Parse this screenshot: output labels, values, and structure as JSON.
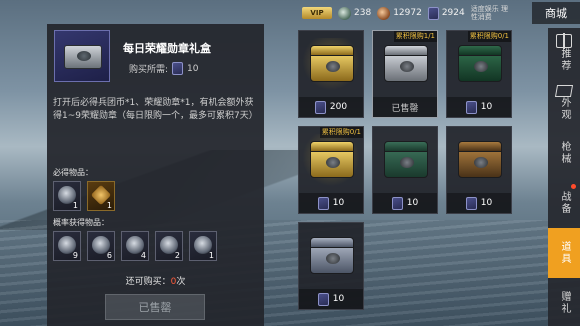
{
  "topbar": {
    "vip_label": "VIP",
    "silver_amount": "238",
    "bronze_amount": "12972",
    "ticket_amount": "2924",
    "note": "适度娱乐 理性消费",
    "shop_label": "商城"
  },
  "detail": {
    "title": "每日荣耀勋章礼盒",
    "cost_label": "购买所需:",
    "cost_value": "10",
    "description": "打开后必得兵团币*1、荣耀勋章*1，有机会额外获得1~9荣耀勋章（每日限购一个，最多可累积7天）",
    "guaranteed_label": "必得物品：",
    "guaranteed_items": [
      {
        "name": "兵团币",
        "count": "1"
      },
      {
        "name": "荣耀勋章",
        "count": "1"
      }
    ],
    "chance_label": "概率获得物品：",
    "chance_items": [
      {
        "count": "9"
      },
      {
        "count": "6"
      },
      {
        "count": "4"
      },
      {
        "count": "2"
      },
      {
        "count": "1"
      }
    ],
    "remain_prefix": "还可购买：",
    "remain_value": "0",
    "remain_suffix": "次",
    "sold_button": "已售罄"
  },
  "cards": [
    {
      "name": "gold-chest",
      "color": "gold",
      "limit": "",
      "price": "200",
      "sold": false
    },
    {
      "name": "silver-chest",
      "color": "silver",
      "limit": "累积限购1/1",
      "price": "已售罄",
      "sold": true
    },
    {
      "name": "green-chest",
      "color": "green",
      "limit": "累积限购0/1",
      "price": "10",
      "sold": false
    },
    {
      "name": "gold-chest-2",
      "color": "gold",
      "limit": "累积限购0/1",
      "price": "10",
      "sold": false
    },
    {
      "name": "darkgreen-chest",
      "color": "darkgreen",
      "limit": "",
      "price": "10",
      "sold": false
    },
    {
      "name": "brown-chest",
      "color": "brown",
      "limit": "",
      "price": "10",
      "sold": false
    },
    {
      "name": "steel-chest",
      "color": "steel",
      "limit": "",
      "price": "10",
      "sold": false
    }
  ],
  "tabs": [
    {
      "label": "推荐",
      "icon": "gift-icon"
    },
    {
      "label": "外观",
      "icon": "box-icon"
    },
    {
      "label": "枪械"
    },
    {
      "label": "战备",
      "dot": true
    },
    {
      "label": "道具",
      "active": true
    },
    {
      "label": "赠礼"
    }
  ]
}
